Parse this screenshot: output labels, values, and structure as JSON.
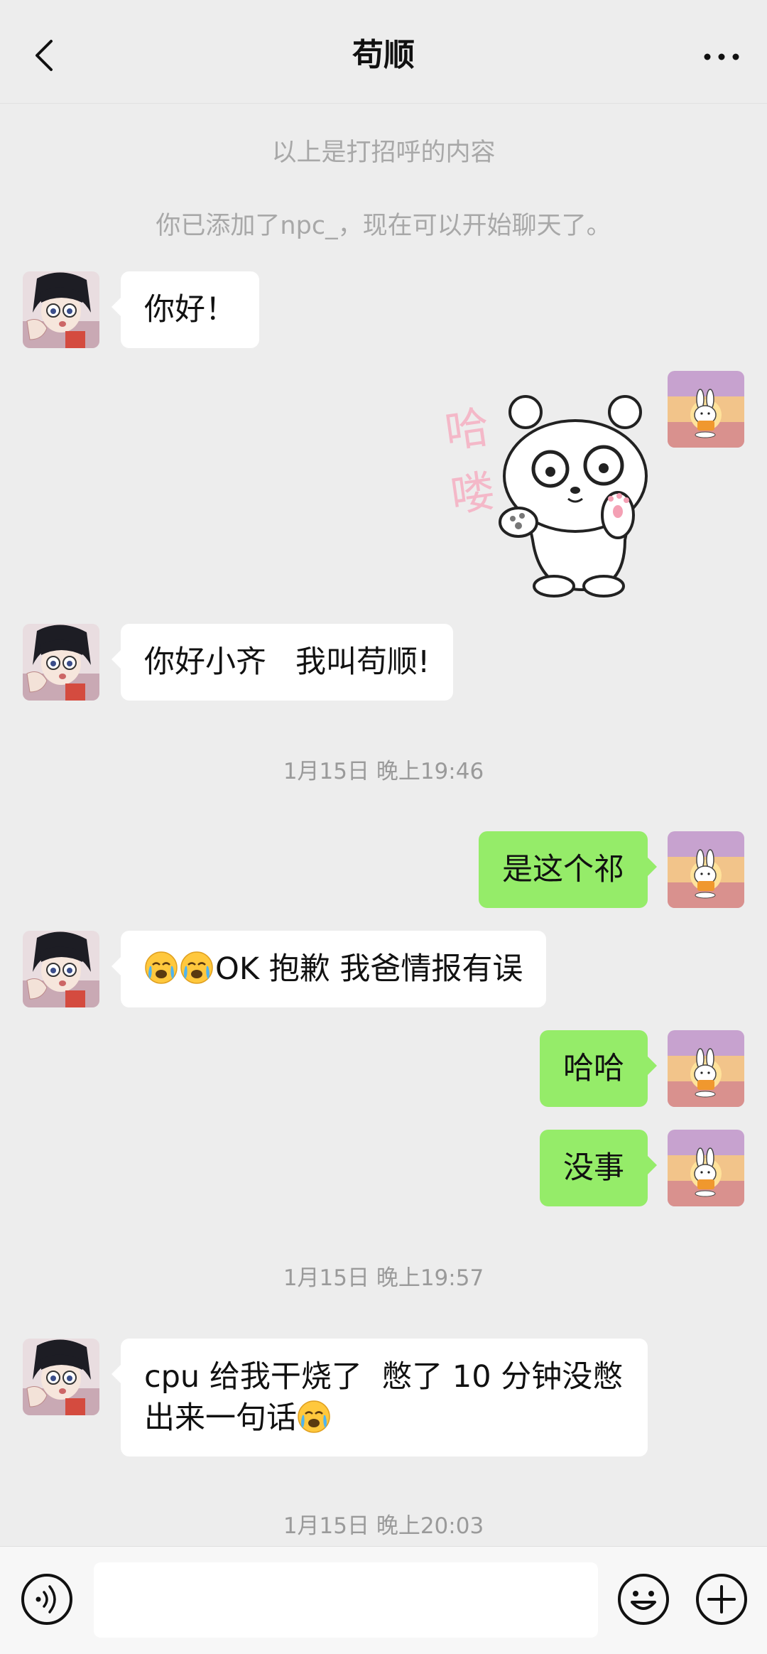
{
  "header": {
    "title": "苟顺",
    "back_icon": "chevron-left-icon",
    "more_icon": "more-dots-icon"
  },
  "system": {
    "greeting_note": "以上是打招呼的内容",
    "added_note": "你已添加了npc_，现在可以开始聊天了。"
  },
  "messages": {
    "m1": "你好！",
    "m3": "你好小齐   我叫苟顺!",
    "t1": "1月15日 晚上19:46",
    "m4": "是这个祁",
    "m5": "OK 抱歉 我爸情报有误",
    "m6": "哈哈",
    "m7": "没事",
    "t2": "1月15日 晚上19:57",
    "m8_line1": "cpu 给我干烧了  憋了 10 分钟没憋",
    "m8_line2": "出来一句话",
    "t3": "1月15日 晚上20:03"
  },
  "sticker": {
    "text": "哈喽"
  },
  "input": {
    "voice_icon": "voice-icon",
    "emoji_icon": "emoji-face-icon",
    "plus_icon": "plus-circle-icon",
    "value": ""
  },
  "colors": {
    "background": "#EDEDED",
    "bubble_in": "#FFFFFF",
    "bubble_out": "#95EC69",
    "system_text": "#A8A8A8"
  }
}
